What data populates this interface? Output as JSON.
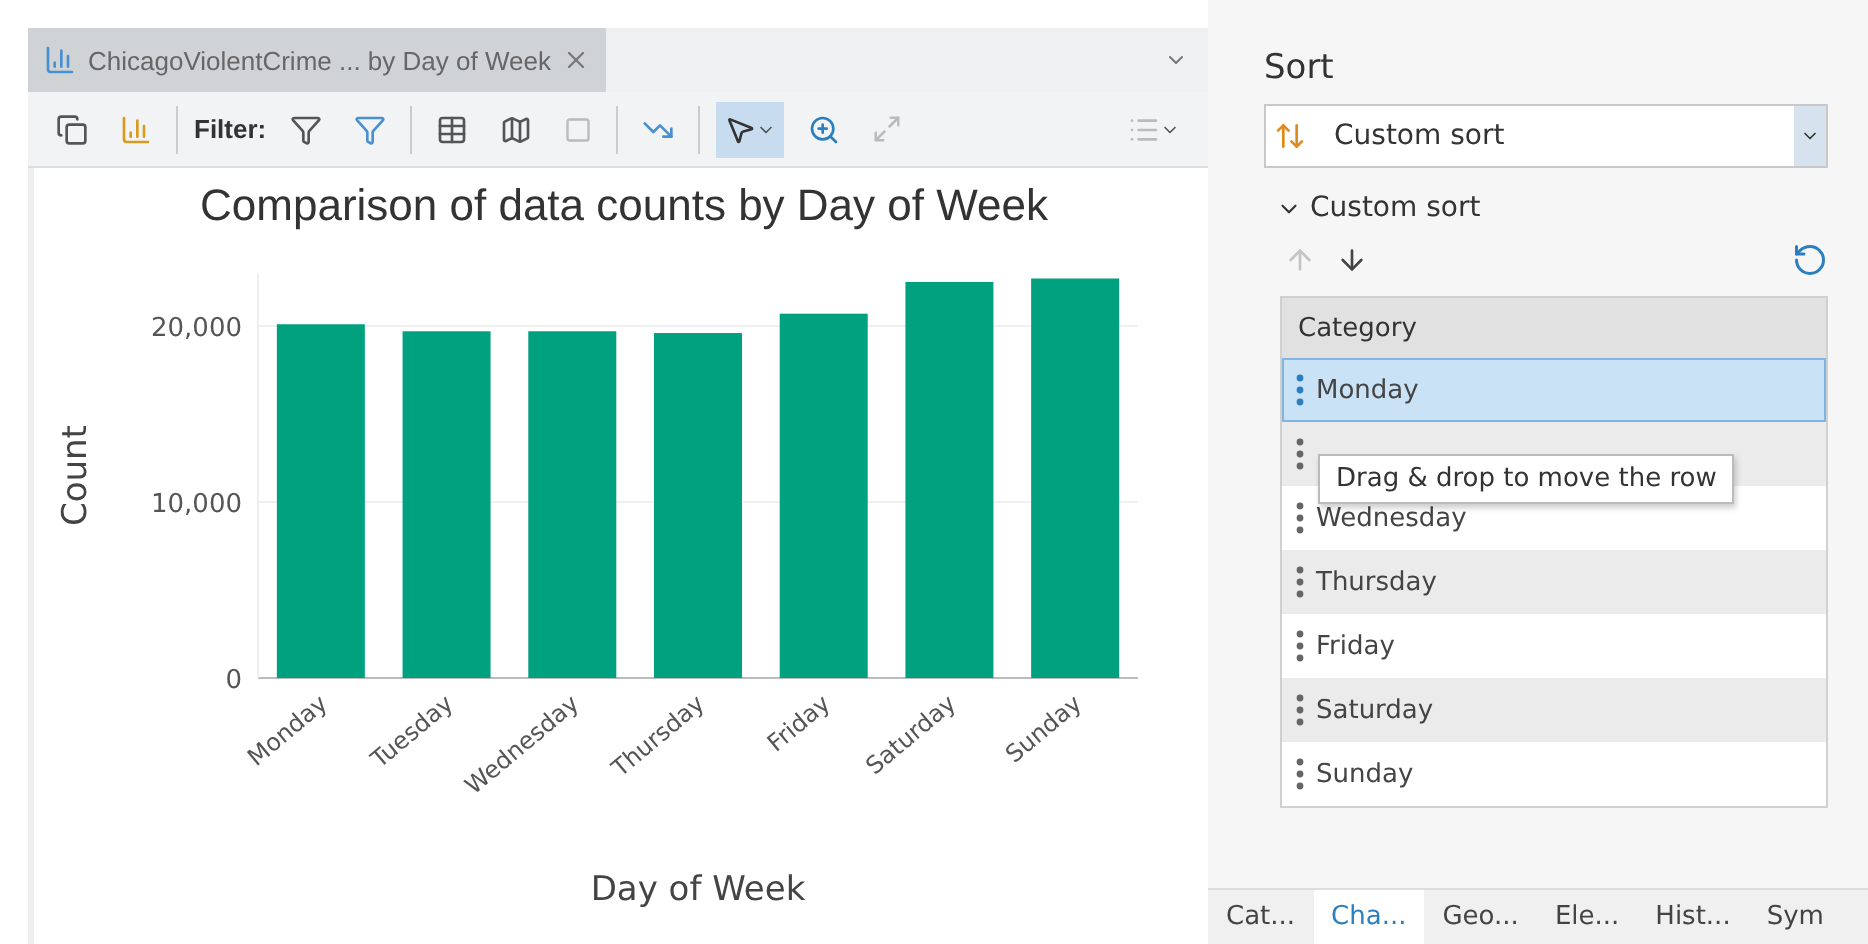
{
  "chart_view": {
    "tab_title": "ChicagoViolentCrime ... by Day of Week",
    "toolbar": {
      "filter_label": "Filter:",
      "select_tool_selected": true
    },
    "chart_data": {
      "type": "bar",
      "title": "Comparison of data counts by Day of Week",
      "xlabel": "Day of Week",
      "ylabel": "Count",
      "categories": [
        "Monday",
        "Tuesday",
        "Wednesday",
        "Thursday",
        "Friday",
        "Saturday",
        "Sunday"
      ],
      "series": [
        {
          "color": "#00a17e",
          "values": [
            20100,
            19700,
            19700,
            19600,
            20700,
            22500,
            22700
          ]
        }
      ],
      "ylim": [
        0,
        23000
      ],
      "yticks": [
        {
          "value": 0,
          "label": "0"
        },
        {
          "value": 10000,
          "label": "10,000"
        },
        {
          "value": 20000,
          "label": "20,000"
        }
      ]
    }
  },
  "sort_panel": {
    "heading": "Sort",
    "dropdown_value": "Custom sort",
    "section_title": "Custom sort",
    "expanded": true,
    "move_up_disabled": true,
    "column_header": "Category",
    "rows": [
      {
        "label": "Monday",
        "selected": true
      },
      {
        "selected": false
      },
      {
        "label": "Wednesday",
        "selected": false
      },
      {
        "label": "Thursday",
        "selected": false
      },
      {
        "label": "Friday",
        "selected": false
      },
      {
        "label": "Saturday",
        "selected": false
      },
      {
        "label": "Sunday",
        "selected": false
      }
    ],
    "tooltip": "Drag & drop to move the row"
  },
  "bottom_tabs": [
    {
      "label": "Cat...",
      "selected": false
    },
    {
      "label": "Cha...",
      "selected": true
    },
    {
      "label": "Geo...",
      "selected": false
    },
    {
      "label": "Ele...",
      "selected": false
    },
    {
      "label": "Hist...",
      "selected": false
    },
    {
      "label": "Sym",
      "selected": false
    }
  ]
}
